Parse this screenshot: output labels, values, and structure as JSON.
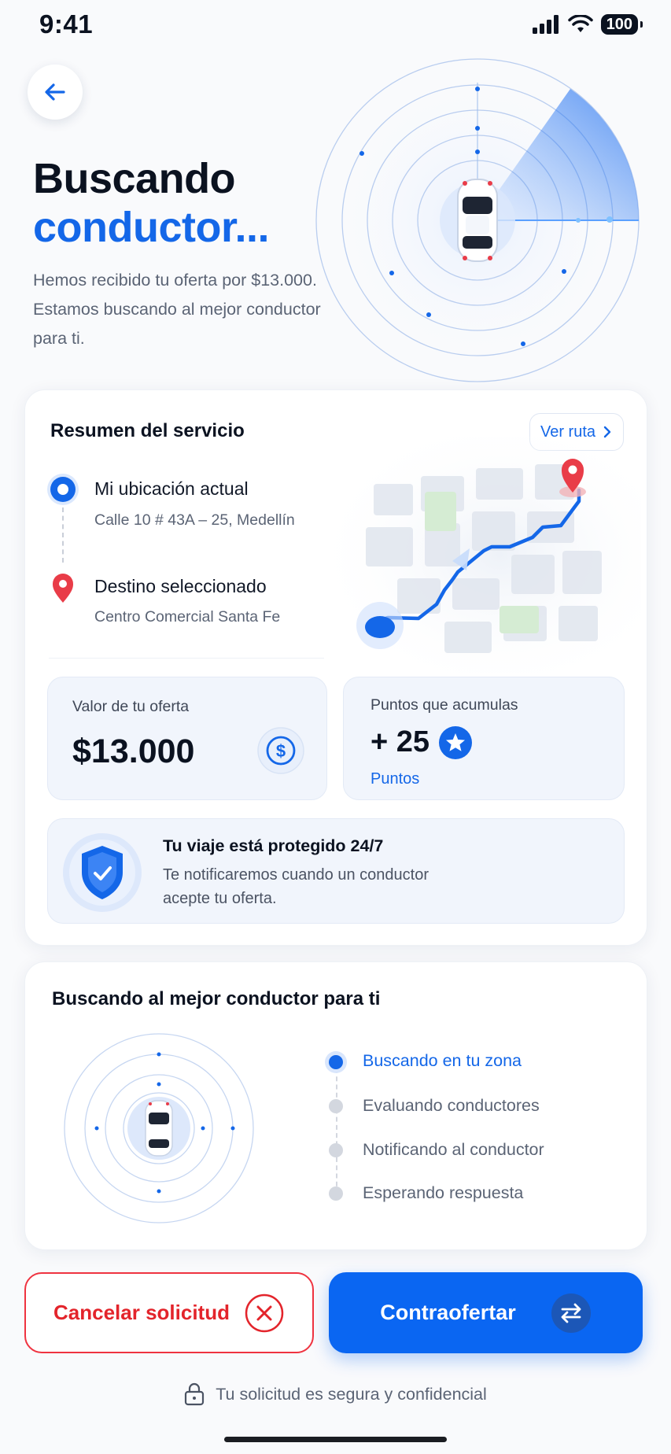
{
  "status_bar": {
    "time": "9:41",
    "battery": "100"
  },
  "header": {
    "title_line1": "Buscando",
    "title_line2": "conductor...",
    "subtitle": "Hemos recibido tu oferta por $13.000. Estamos buscando al mejor conductor para ti."
  },
  "service": {
    "title": "Resumen del servicio",
    "route_button": "Ver ruta",
    "origin": {
      "title": "Mi ubicación actual",
      "address": "Calle 10 # 43A – 25, Medellín"
    },
    "destination": {
      "title": "Destino seleccionado",
      "address": "Centro Comercial Santa Fe"
    },
    "offer": {
      "label": "Valor de tu oferta",
      "value": "$13.000"
    },
    "points": {
      "label": "Puntos que acumulas",
      "value": "+ 25",
      "unit": "Puntos"
    },
    "protection": {
      "title": "Tu viaje está protegido 24/7",
      "line1": "Te notificaremos cuando un conductor",
      "line2": "acepte tu oferta."
    }
  },
  "search": {
    "title": "Buscando al mejor conductor para ti",
    "steps": [
      {
        "label": "Buscando en tu zona",
        "active": true
      },
      {
        "label": "Evaluando conductores",
        "active": false
      },
      {
        "label": "Notificando al conductor",
        "active": false
      },
      {
        "label": "Esperando respuesta",
        "active": false
      }
    ]
  },
  "actions": {
    "cancel": "Cancelar solicitud",
    "counter": "Contraofertar"
  },
  "footer": {
    "secure_note": "Tu solicitud es segura y confidencial"
  },
  "colors": {
    "primary": "#1467E8",
    "danger": "#E3242B",
    "dark": "#0B1220"
  },
  "icons": [
    "back-arrow-icon",
    "signal-icon",
    "wifi-icon",
    "battery-icon",
    "chevron-right-icon",
    "location-pin-icon",
    "dollar-icon",
    "star-icon",
    "shield-icon",
    "close-icon",
    "swap-icon",
    "lock-icon"
  ]
}
